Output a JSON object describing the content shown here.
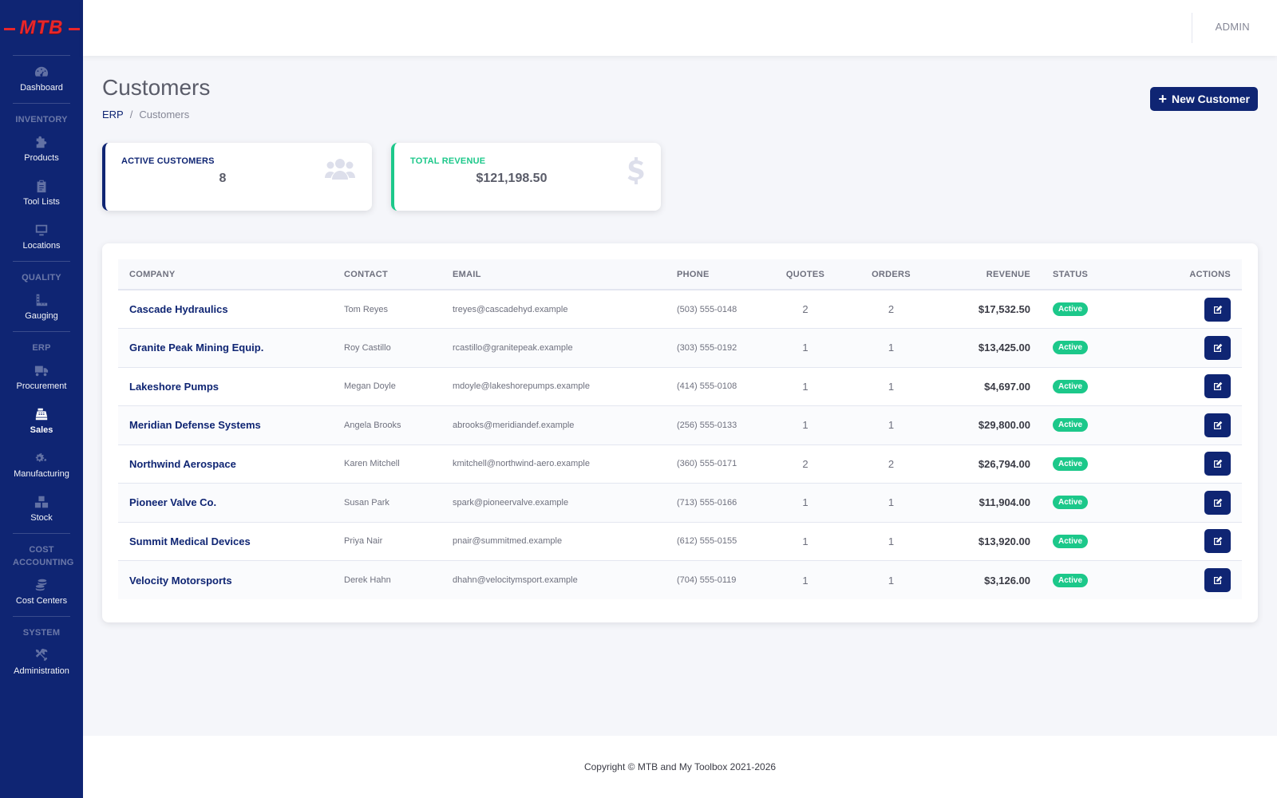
{
  "app": {
    "logo_text": "MTB",
    "user_label": "ADMIN"
  },
  "sidebar": {
    "dashboard": {
      "label": "Dashboard",
      "icon": "dashboard-gauge-icon"
    },
    "sections": {
      "inventory": "INVENTORY",
      "quality": "QUALITY",
      "erp": "ERP",
      "cost_accounting": "COST ACCOUNTING",
      "system": "SYSTEM"
    },
    "items": {
      "products": {
        "label": "Products",
        "icon": "puzzle-icon"
      },
      "tool_lists": {
        "label": "Tool Lists",
        "icon": "clipboard-icon"
      },
      "locations": {
        "label": "Locations",
        "icon": "monitor-icon"
      },
      "gauging": {
        "label": "Gauging",
        "icon": "ruler-icon"
      },
      "procurement": {
        "label": "Procurement",
        "icon": "truck-icon"
      },
      "sales": {
        "label": "Sales",
        "icon": "cash-register-icon",
        "active": true
      },
      "manufacturing": {
        "label": "Manufacturing",
        "icon": "cogs-icon"
      },
      "stock": {
        "label": "Stock",
        "icon": "boxes-icon"
      },
      "cost_centers": {
        "label": "Cost Centers",
        "icon": "coins-icon"
      },
      "administration": {
        "label": "Administration",
        "icon": "tools-icon"
      }
    }
  },
  "page": {
    "title": "Customers",
    "breadcrumb": {
      "root": "ERP",
      "separator": "/",
      "current": "Customers"
    },
    "new_button_label": "New Customer"
  },
  "stats": {
    "active_customers": {
      "label": "ACTIVE CUSTOMERS",
      "value": "8",
      "icon": "users-icon"
    },
    "total_revenue": {
      "label": "TOTAL REVENUE",
      "value": "$121,198.50",
      "icon": "dollar-icon"
    }
  },
  "table": {
    "columns": [
      "COMPANY",
      "CONTACT",
      "EMAIL",
      "PHONE",
      "QUOTES",
      "ORDERS",
      "REVENUE",
      "STATUS",
      "ACTIONS"
    ],
    "rows": [
      {
        "company": "Cascade Hydraulics",
        "contact": "Tom Reyes",
        "email": "treyes@cascadehyd.example",
        "phone": "(503) 555-0148",
        "quotes": "2",
        "orders": "2",
        "revenue": "$17,532.50",
        "status": "Active"
      },
      {
        "company": "Granite Peak Mining Equip.",
        "contact": "Roy Castillo",
        "email": "rcastillo@granitepeak.example",
        "phone": "(303) 555-0192",
        "quotes": "1",
        "orders": "1",
        "revenue": "$13,425.00",
        "status": "Active"
      },
      {
        "company": "Lakeshore Pumps",
        "contact": "Megan Doyle",
        "email": "mdoyle@lakeshorepumps.example",
        "phone": "(414) 555-0108",
        "quotes": "1",
        "orders": "1",
        "revenue": "$4,697.00",
        "status": "Active"
      },
      {
        "company": "Meridian Defense Systems",
        "contact": "Angela Brooks",
        "email": "abrooks@meridiandef.example",
        "phone": "(256) 555-0133",
        "quotes": "1",
        "orders": "1",
        "revenue": "$29,800.00",
        "status": "Active"
      },
      {
        "company": "Northwind Aerospace",
        "contact": "Karen Mitchell",
        "email": "kmitchell@northwind-aero.example",
        "phone": "(360) 555-0171",
        "quotes": "2",
        "orders": "2",
        "revenue": "$26,794.00",
        "status": "Active"
      },
      {
        "company": "Pioneer Valve Co.",
        "contact": "Susan Park",
        "email": "spark@pioneervalve.example",
        "phone": "(713) 555-0166",
        "quotes": "1",
        "orders": "1",
        "revenue": "$11,904.00",
        "status": "Active"
      },
      {
        "company": "Summit Medical Devices",
        "contact": "Priya Nair",
        "email": "pnair@summitmed.example",
        "phone": "(612) 555-0155",
        "quotes": "1",
        "orders": "1",
        "revenue": "$13,920.00",
        "status": "Active"
      },
      {
        "company": "Velocity Motorsports",
        "contact": "Derek Hahn",
        "email": "dhahn@velocitymsport.example",
        "phone": "(704) 555-0119",
        "quotes": "1",
        "orders": "1",
        "revenue": "$3,126.00",
        "status": "Active"
      }
    ],
    "edit_icon": "edit-icon"
  },
  "footer": {
    "text": "Copyright © MTB and My Toolbox 2021-2026"
  },
  "colors": {
    "primary": "#0f2573",
    "success": "#1cc88a",
    "logo_red": "#e8262a"
  }
}
